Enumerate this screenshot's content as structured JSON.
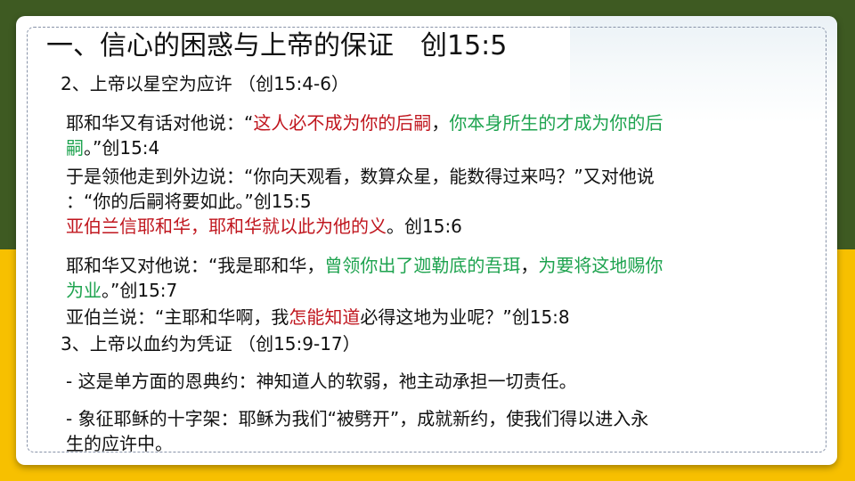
{
  "title": "一、信心的困惑与上帝的保证　创15:5",
  "section2": {
    "heading": "2、上帝以星空为应许 （创15:4-6）",
    "v1_line1_a": "耶和华又有话对他说：“",
    "v1_line1_b": "这人必不成为你的后嗣",
    "v1_line1_c": "，",
    "v1_line1_d": "你本身所生的才成为你的后",
    "v1_line2_a": "嗣",
    "v1_line2_b": "。”创15:4",
    "v2_line1": "于是领他走到外边说：“你向天观看，数算众星，能数得过来吗？”又对他说",
    "v2_line2": "：“你的后嗣将要如此。”创15:5",
    "v3_a": "亚伯兰信耶和华，耶和华就以此为他的义",
    "v3_b": "。创15:6",
    "v4_line1_a": "耶和华又对他说：“我是耶和华，",
    "v4_line1_b": "曾领你出了迦勒底的吾珥",
    "v4_line1_c": "，",
    "v4_line1_d": "为要将这地赐你",
    "v4_line2_a": "为业",
    "v4_line2_b": "。”创15:7",
    "v5_a": "亚伯兰说：“主耶和华啊，我",
    "v5_b": "怎能知道",
    "v5_c": "必得这地为业呢？”创15:8"
  },
  "section3": {
    "heading": "3、上帝以血约为凭证 （创15:9-17）",
    "p1": "- 这是单方面的恩典约：神知道人的软弱，祂主动承担一切责任。",
    "p2_line1": "- 象征耶稣的十字架：耶稣为我们“被劈开”，成就新约，使我们得以进入永",
    "p2_line2": "生的应许中。"
  },
  "colors": {
    "top_band": "#3e5a22",
    "bottom_band": "#f7c000",
    "emphasis_red": "#c0161e",
    "emphasis_green": "#1ea34f"
  }
}
